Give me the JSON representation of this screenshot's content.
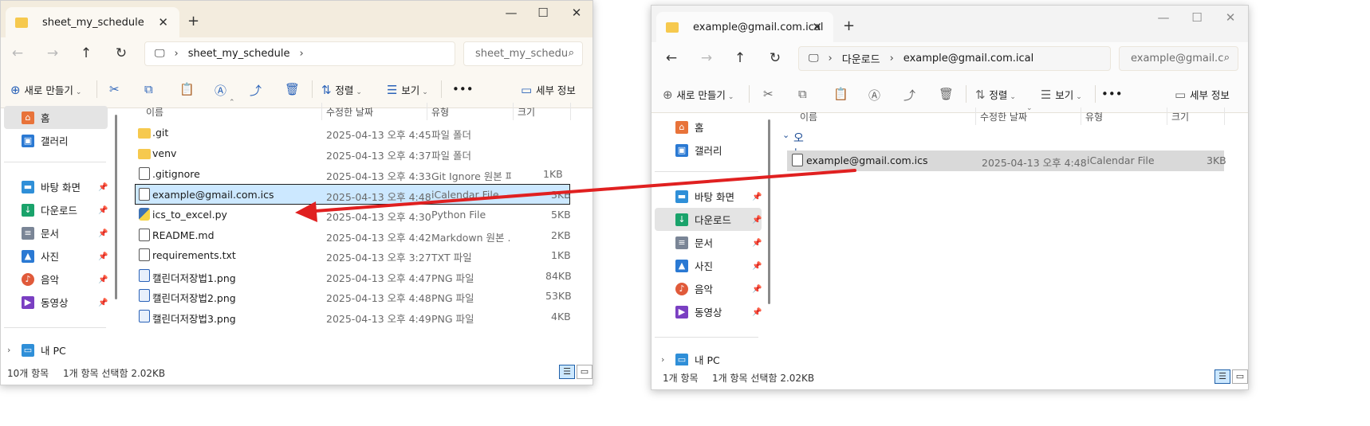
{
  "left": {
    "tab_title": "sheet_my_schedule",
    "breadcrumb": [
      "sheet_my_schedule"
    ],
    "search_placeholder": "sheet_my_schedu",
    "toolbar": {
      "new": "새로 만들기",
      "sort": "정렬",
      "view": "보기",
      "details": "세부 정보"
    },
    "sidebar": [
      {
        "label": "홈",
        "icon": "home-icon",
        "color": "#e8733a"
      },
      {
        "label": "갤러리",
        "icon": "gallery-icon",
        "color": "#2a79d3"
      },
      {
        "label": "바탕 화면",
        "icon": "desktop-icon",
        "color": "#2f8fd8"
      },
      {
        "label": "다운로드",
        "icon": "download-icon",
        "color": "#1aa36b"
      },
      {
        "label": "문서",
        "icon": "documents-icon",
        "color": "#7a8596"
      },
      {
        "label": "사진",
        "icon": "pictures-icon",
        "color": "#2a79d3"
      },
      {
        "label": "음악",
        "icon": "music-icon",
        "color": "#e05a3a"
      },
      {
        "label": "동영상",
        "icon": "videos-icon",
        "color": "#7a3fc2"
      },
      {
        "label": "내 PC",
        "icon": "pc-icon",
        "color": "#2f8fd8"
      }
    ],
    "columns": [
      "이름",
      "수정한 날짜",
      "유형",
      "크기"
    ],
    "files": [
      {
        "name": ".git",
        "date": "2025-04-13 오후 4:45",
        "type": "파일 폴더",
        "size": "",
        "kind": "folder"
      },
      {
        "name": "venv",
        "date": "2025-04-13 오후 4:37",
        "type": "파일 폴더",
        "size": "",
        "kind": "folder"
      },
      {
        "name": ".gitignore",
        "date": "2025-04-13 오후 4:33",
        "type": "Git Ignore 원본 파",
        "size": "1KB",
        "kind": "doc"
      },
      {
        "name": "example@gmail.com.ics",
        "date": "2025-04-13 오후 4:48",
        "type": "iCalendar File",
        "size": "3KB",
        "kind": "doc"
      },
      {
        "name": "ics_to_excel.py",
        "date": "2025-04-13 오후 4:30",
        "type": "Python File",
        "size": "5KB",
        "kind": "py"
      },
      {
        "name": "README.md",
        "date": "2025-04-13 오후 4:42",
        "type": "Markdown 원본 ...",
        "size": "2KB",
        "kind": "doc"
      },
      {
        "name": "requirements.txt",
        "date": "2025-04-13 오후 3:27",
        "type": "TXT 파일",
        "size": "1KB",
        "kind": "doc"
      },
      {
        "name": "캘린더저장법1.png",
        "date": "2025-04-13 오후 4:47",
        "type": "PNG 파일",
        "size": "84KB",
        "kind": "png"
      },
      {
        "name": "캘린더저장법2.png",
        "date": "2025-04-13 오후 4:48",
        "type": "PNG 파일",
        "size": "53KB",
        "kind": "png"
      },
      {
        "name": "캘린더저장법3.png",
        "date": "2025-04-13 오후 4:49",
        "type": "PNG 파일",
        "size": "4KB",
        "kind": "png"
      }
    ],
    "status_count": "10개 항목",
    "status_selected": "1개 항목 선택함 2.02KB"
  },
  "right": {
    "tab_title": "example@gmail.com.ical",
    "breadcrumb": [
      "다운로드",
      "example@gmail.com.ical"
    ],
    "search_placeholder": "example@gmail.c",
    "toolbar": {
      "new": "새로 만들기",
      "sort": "정렬",
      "view": "보기",
      "details": "세부 정보"
    },
    "sidebar": [
      {
        "label": "홈",
        "icon": "home-icon",
        "color": "#e8733a"
      },
      {
        "label": "갤러리",
        "icon": "gallery-icon",
        "color": "#2a79d3"
      },
      {
        "label": "바탕 화면",
        "icon": "desktop-icon",
        "color": "#2f8fd8"
      },
      {
        "label": "다운로드",
        "icon": "download-icon",
        "color": "#1aa36b"
      },
      {
        "label": "문서",
        "icon": "documents-icon",
        "color": "#7a8596"
      },
      {
        "label": "사진",
        "icon": "pictures-icon",
        "color": "#2a79d3"
      },
      {
        "label": "음악",
        "icon": "music-icon",
        "color": "#e05a3a"
      },
      {
        "label": "동영상",
        "icon": "videos-icon",
        "color": "#7a3fc2"
      },
      {
        "label": "내 PC",
        "icon": "pc-icon",
        "color": "#2f8fd8"
      }
    ],
    "columns": [
      "이름",
      "수정한 날짜",
      "유형",
      "크기"
    ],
    "group_label": "오늘",
    "files": [
      {
        "name": "example@gmail.com.ics",
        "date": "2025-04-13 오후 4:48",
        "type": "iCalendar File",
        "size": "3KB",
        "kind": "doc"
      }
    ],
    "status_count": "1개 항목",
    "status_selected": "1개 항목 선택함 2.02KB"
  },
  "colors": {
    "selection": "#cce8ff",
    "accent": "#2a62b8",
    "arrow": "#e02020",
    "chrome": "#f3ecde"
  }
}
